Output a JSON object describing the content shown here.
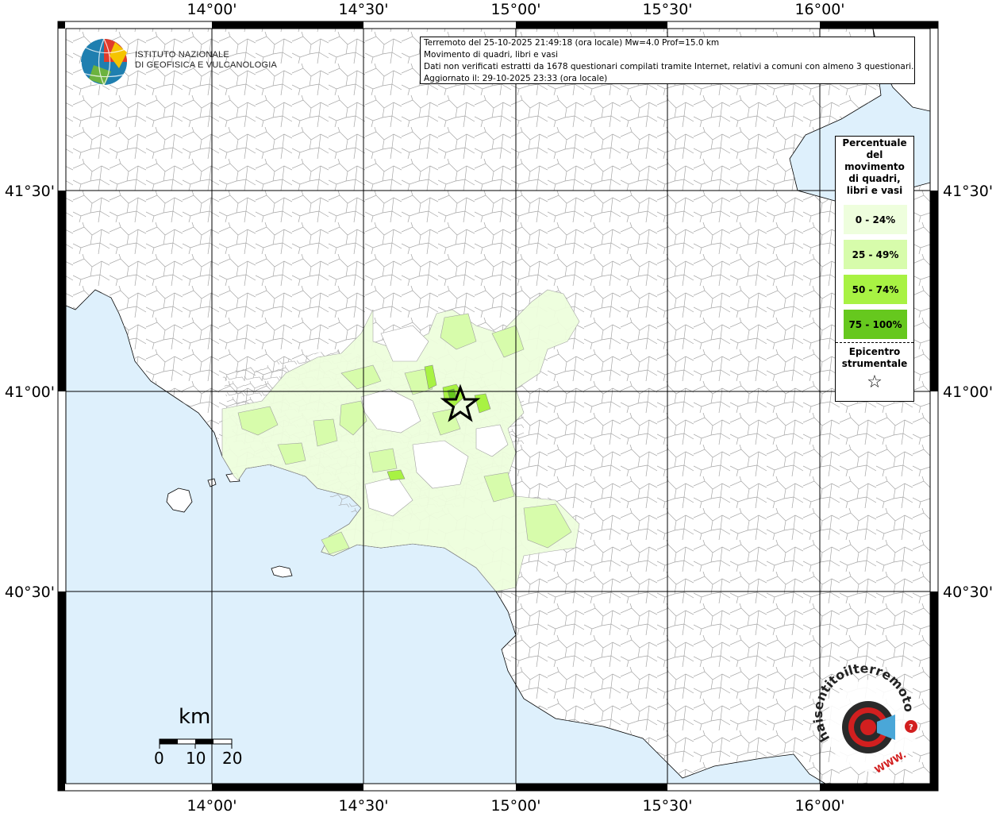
{
  "header": {
    "line1": "Terremoto del 25-10-2025 21:49:18 (ora locale) Mw=4.0 Prof=15.0 km",
    "line2": "Movimento di quadri, libri e vasi",
    "line3": "Dati non verificati estratti da 1678 questionari compilati tramite Internet, relativi a comuni con almeno 3 questionari.",
    "line4": "Aggiornato il: 29-10-2025 23:33 (ora locale)"
  },
  "institute": {
    "line1": "ISTITUTO NAZIONALE",
    "line2": "DI GEOFISICA E VULCANOLOGIA"
  },
  "grid": {
    "lon_labels": [
      "14°00'",
      "14°30'",
      "15°00'",
      "15°30'",
      "16°00'"
    ],
    "lat_labels": [
      "41°30'",
      "41°00'",
      "40°30'"
    ]
  },
  "legend": {
    "title": "Percentuale del movimento di quadri, libri e vasi",
    "classes": [
      {
        "label": "0 - 24%",
        "color": "#eefedd"
      },
      {
        "label": "25 - 49%",
        "color": "#d7fcab"
      },
      {
        "label": "50 - 74%",
        "color": "#a8f243"
      },
      {
        "label": "75 - 100%",
        "color": "#66c81e"
      }
    ],
    "epicenter_label": "Epicentro strumentale",
    "epicenter_symbol": "☆"
  },
  "scale": {
    "unit": "km",
    "ticks": [
      "0",
      "10",
      "20"
    ]
  },
  "logo_text": {
    "ring_text": "haisentitoilterremoto.it",
    "www": "WWW."
  },
  "colors": {
    "sea": "#def0fc",
    "land": "#ffffff",
    "boundary": "#888888",
    "grid": "#000000"
  }
}
